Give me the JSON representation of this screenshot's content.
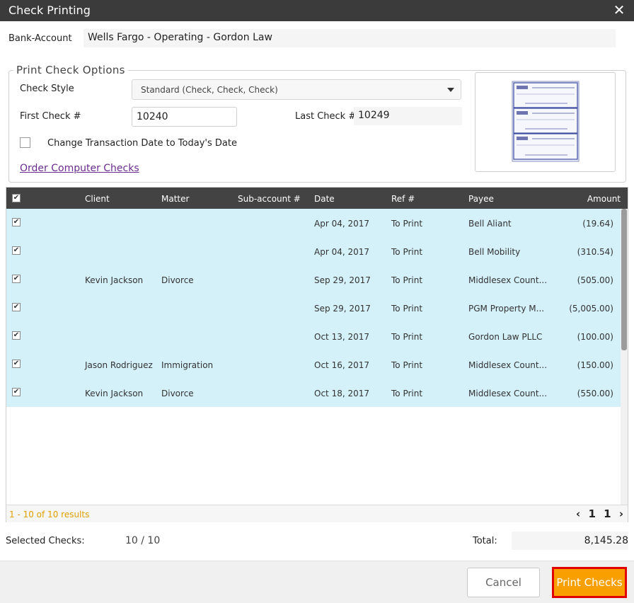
{
  "window": {
    "title": "Check Printing",
    "close_glyph": "✕"
  },
  "bank": {
    "label": "Bank-Account",
    "value": "Wells Fargo - Operating - Gordon Law"
  },
  "options": {
    "legend": "Print Check Options",
    "check_style_label": "Check Style",
    "check_style_value": "Standard (Check, Check, Check)",
    "first_check_label": "First Check #",
    "first_check_value": "10240",
    "last_check_label": "Last Check #",
    "last_check_value": "10249",
    "change_date_label": "Change Transaction Date to Today's Date",
    "order_link": "Order Computer Checks"
  },
  "table": {
    "headers": {
      "client": "Client",
      "matter": "Matter",
      "subaccount": "Sub-account #",
      "date": "Date",
      "ref": "Ref #",
      "payee": "Payee",
      "amount": "Amount"
    },
    "check_glyph": "✔",
    "rows": [
      {
        "client": "",
        "matter": "",
        "subaccount": "",
        "date": "Apr 04, 2017",
        "ref": "To Print",
        "payee": "Bell Aliant",
        "amount": "(19.64)"
      },
      {
        "client": "",
        "matter": "",
        "subaccount": "",
        "date": "Apr 04, 2017",
        "ref": "To Print",
        "payee": "Bell Mobility",
        "amount": "(310.54)"
      },
      {
        "client": "Kevin Jackson",
        "matter": "Divorce",
        "subaccount": "",
        "date": "Sep 29, 2017",
        "ref": "To Print",
        "payee": "Middlesex Count...",
        "amount": "(505.00)"
      },
      {
        "client": "",
        "matter": "",
        "subaccount": "",
        "date": "Sep 29, 2017",
        "ref": "To Print",
        "payee": "PGM Property M...",
        "amount": "(5,005.00)"
      },
      {
        "client": "",
        "matter": "",
        "subaccount": "",
        "date": "Oct 13, 2017",
        "ref": "To Print",
        "payee": "Gordon Law PLLC",
        "amount": "(100.00)"
      },
      {
        "client": "Jason Rodriguez",
        "matter": "Immigration",
        "subaccount": "",
        "date": "Oct 16, 2017",
        "ref": "To Print",
        "payee": "Middlesex Count...",
        "amount": "(150.00)"
      },
      {
        "client": "Kevin Jackson",
        "matter": "Divorce",
        "subaccount": "",
        "date": "Oct 18, 2017",
        "ref": "To Print",
        "payee": "Middlesex Count...",
        "amount": "(550.00)"
      }
    ],
    "results_text": "1 - 10 of 10 results",
    "pager": {
      "prev": "‹",
      "first": "1",
      "current": "1",
      "next": "›"
    }
  },
  "summary": {
    "selected_label": "Selected Checks:",
    "selected_value": "10 / 10",
    "total_label": "Total:",
    "total_value": "8,145.28"
  },
  "buttons": {
    "cancel": "Cancel",
    "print": "Print Checks"
  },
  "colors": {
    "accent": "#f9a000",
    "row_selected": "#d4f0f8",
    "link": "#6b2c91",
    "header": "#434343"
  }
}
